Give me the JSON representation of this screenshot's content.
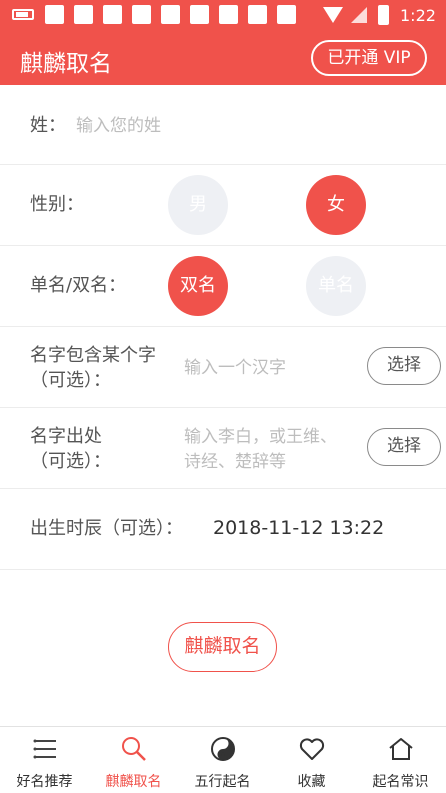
{
  "status_bar": {
    "time": "1:22"
  },
  "app_bar": {
    "title": "麒麟取名",
    "vip_label": "已开通 VIP"
  },
  "form": {
    "surname": {
      "label": "姓：",
      "placeholder": "输入您的姓"
    },
    "gender": {
      "label": "性别：",
      "options": [
        "男",
        "女"
      ],
      "selected": "女"
    },
    "name_type": {
      "label": "单名/双名：",
      "options": [
        "双名",
        "单名"
      ],
      "selected": "双名"
    },
    "contains_char": {
      "label_line1": "名字包含某个字",
      "label_line2": "（可选）：",
      "placeholder": "输入一个汉字",
      "button": "选择"
    },
    "source": {
      "label_line1": "名字出处",
      "label_line2": "（可选）：",
      "placeholder_line1": "输入李白，或王维、",
      "placeholder_line2": "诗经、楚辞等",
      "button": "选择"
    },
    "birth_time": {
      "label": "出生时辰（可选）：",
      "value": "2018-11-12 13:22"
    },
    "submit_label": "麒麟取名"
  },
  "tabs": [
    {
      "label": "好名推荐",
      "icon": "list-icon",
      "active": false
    },
    {
      "label": "麒麟取名",
      "icon": "search-icon",
      "active": true
    },
    {
      "label": "五行起名",
      "icon": "yin-yang-icon",
      "active": false
    },
    {
      "label": "收藏",
      "icon": "heart-icon",
      "active": false
    },
    {
      "label": "起名常识",
      "icon": "home-icon",
      "active": false
    }
  ],
  "colors": {
    "accent": "#f0524b",
    "inactive_circle": "#eef0f4",
    "placeholder": "#bdbdbd"
  }
}
